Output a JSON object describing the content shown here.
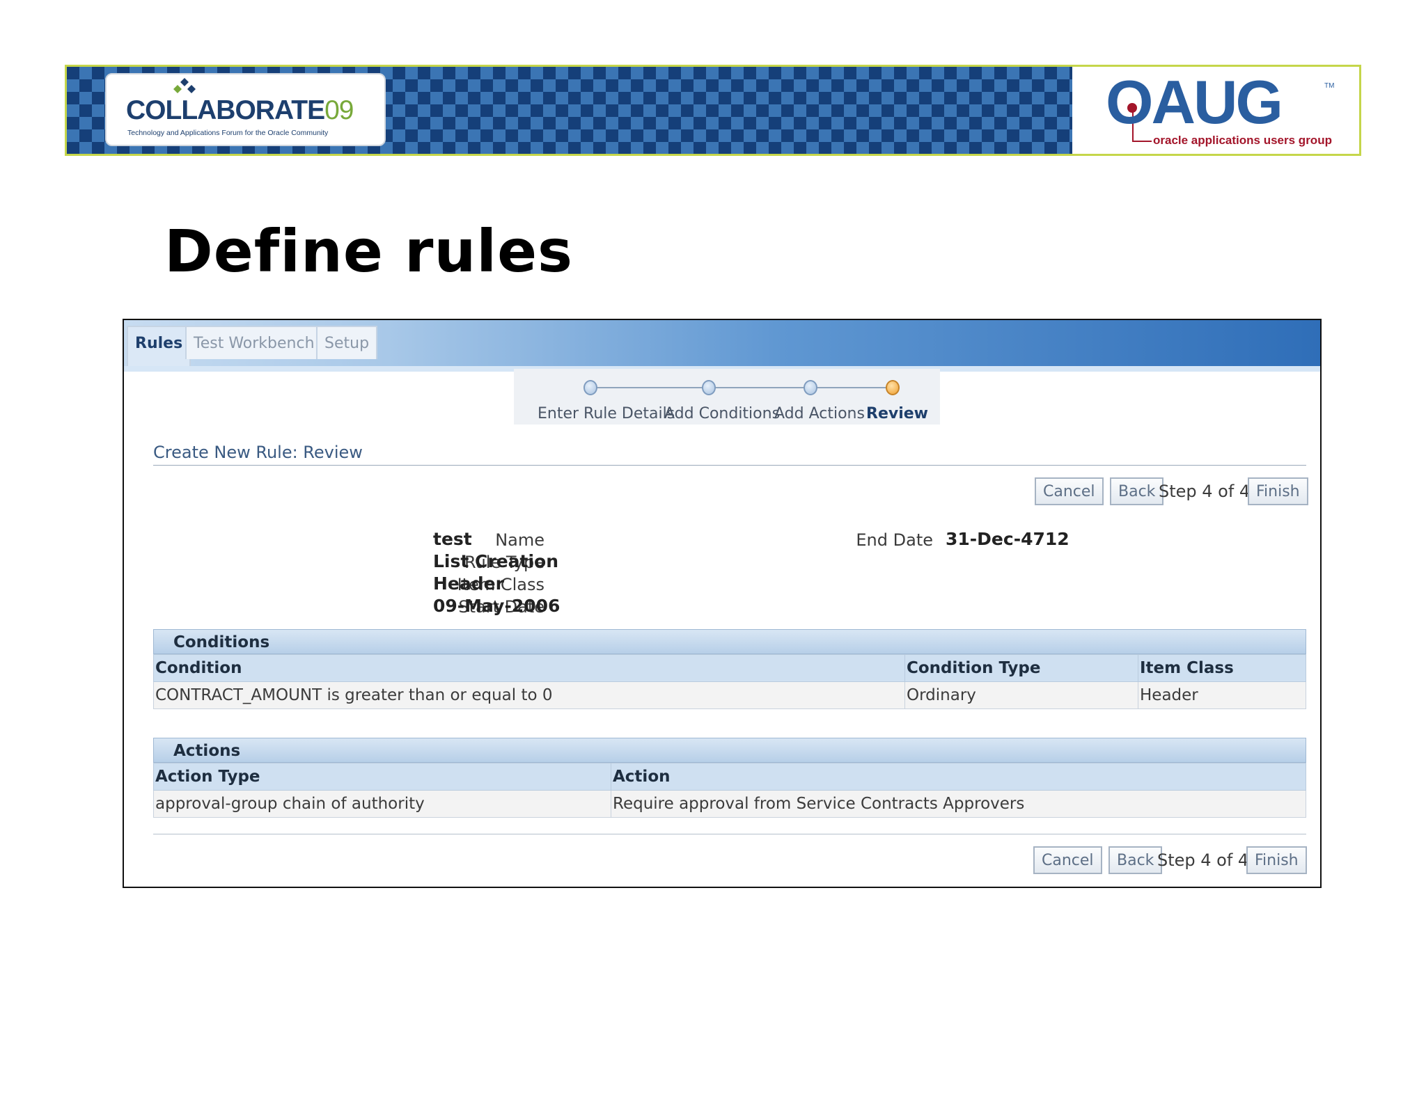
{
  "banner": {
    "collab_title": "COLLABORATE",
    "collab_year": "09",
    "collab_subtitle": "Technology and Applications Forum for the Oracle Community",
    "oaug_logo": "OAUG",
    "oaug_tm": "TM",
    "oaug_subtitle": "oracle applications users group"
  },
  "slide": {
    "title": "Define rules"
  },
  "tabs": [
    {
      "label": "Rules",
      "active": true
    },
    {
      "label": "Test Workbench",
      "active": false
    },
    {
      "label": "Setup",
      "active": false
    }
  ],
  "train": {
    "steps": [
      "Enter Rule Details",
      "Add Conditions",
      "Add Actions",
      "Review"
    ],
    "current": 3
  },
  "page": {
    "header": "Create New Rule: Review",
    "buttons": {
      "cancel": "Cancel",
      "back": "Back",
      "finish": "Finish"
    },
    "step_text": "Step 4 of 4"
  },
  "rule": {
    "name_label": "Name",
    "name": "test",
    "rule_type_label": "Rule Type",
    "rule_type": "List Creation",
    "item_class_label": "Item Class",
    "item_class": "Header",
    "start_date_label": "Start Date",
    "start_date": "09-May-2006",
    "end_date_label": "End Date",
    "end_date": "31-Dec-4712"
  },
  "conditions": {
    "title": "Conditions",
    "columns": [
      "Condition",
      "Condition Type",
      "Item Class"
    ],
    "rows": [
      [
        "CONTRACT_AMOUNT is greater than or equal to 0",
        "Ordinary",
        "Header"
      ]
    ]
  },
  "actions": {
    "title": "Actions",
    "columns": [
      "Action Type",
      "Action"
    ],
    "rows": [
      [
        "approval-group chain of authority",
        "Require approval from Service Contracts Approvers"
      ]
    ]
  },
  "colors": {
    "banner_blue": "#163f7a",
    "banner_border": "#c5d64a",
    "oaug_red": "#a3152a",
    "train_current": "#f0a030"
  }
}
